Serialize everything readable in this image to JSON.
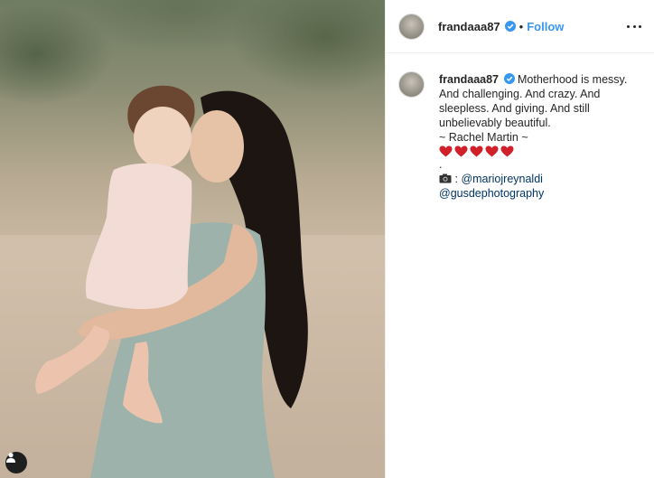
{
  "post": {
    "username": "frandaaa87",
    "follow_label": "Follow",
    "separator": "•",
    "caption": {
      "line1_rest": "Motherhood is messy.",
      "line2": "And challenging. And crazy. And",
      "line3": "sleepless. And giving. And still",
      "line4": "unbelievably beautiful.",
      "line5": "~ Rachel Martin ~",
      "hearts": 5,
      "line_dot": ".",
      "credit_prefix": ": ",
      "mention1": "@mariojreynaldi",
      "mention2": "@gusdephotography"
    }
  },
  "icons": {
    "verified": "verified-badge-icon",
    "more": "more-options-icon",
    "heart": "red-heart-icon",
    "camera": "camera-icon",
    "profile": "user-profile-icon"
  },
  "colors": {
    "link_blue": "#3897f0",
    "mention": "#003569",
    "heart_red": "#d0212a",
    "dress": "#9eb2ac"
  }
}
